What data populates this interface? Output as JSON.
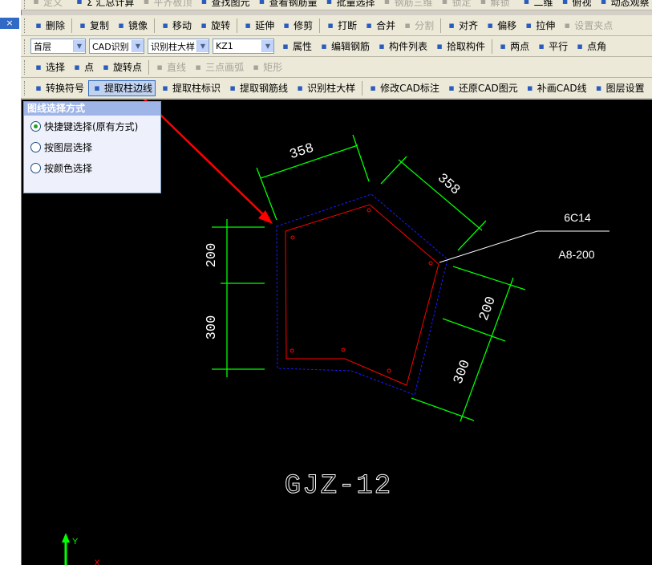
{
  "toolbar_row0": [
    {
      "icon": "definition-icon",
      "label": "定义",
      "disabled": true
    },
    {
      "icon": "sigma-icon",
      "label": "Σ 汇总计算",
      "disabled": false
    },
    {
      "icon": "align-top-icon",
      "label": "平齐板顶",
      "disabled": true
    },
    {
      "icon": "find-icon",
      "label": "查找图元",
      "disabled": false
    },
    {
      "icon": "rebar-view-icon",
      "label": "查看钢筋量",
      "disabled": false
    },
    {
      "icon": "batch-select-icon",
      "label": "批量选择",
      "disabled": false
    },
    {
      "icon": "rebar-3d-icon",
      "label": "钢筋三维",
      "disabled": true
    },
    {
      "icon": "lock-icon",
      "label": "锁定",
      "disabled": true
    },
    {
      "icon": "unlock-icon",
      "label": "解锁",
      "disabled": true
    },
    {
      "icon": "2d-icon",
      "label": "二维",
      "disabled": false
    },
    {
      "icon": "top-view-icon",
      "label": "俯视",
      "disabled": false
    },
    {
      "icon": "dynamic-view-icon",
      "label": "动态观察",
      "disabled": false
    }
  ],
  "toolbar_row1": [
    {
      "icon": "delete-icon",
      "label": "删除",
      "disabled": false
    },
    {
      "icon": "copy-icon",
      "label": "复制",
      "disabled": false
    },
    {
      "icon": "mirror-icon",
      "label": "镜像",
      "disabled": false
    },
    {
      "icon": "move-icon",
      "label": "移动",
      "disabled": false
    },
    {
      "icon": "rotate-icon",
      "label": "旋转",
      "disabled": false
    },
    {
      "icon": "extend-icon",
      "label": "延伸",
      "disabled": false
    },
    {
      "icon": "trim-icon",
      "label": "修剪",
      "disabled": false
    },
    {
      "icon": "break-icon",
      "label": "打断",
      "disabled": false
    },
    {
      "icon": "merge-icon",
      "label": "合并",
      "disabled": false
    },
    {
      "icon": "split-icon",
      "label": "分割",
      "disabled": true
    },
    {
      "icon": "align-icon",
      "label": "对齐",
      "disabled": false
    },
    {
      "icon": "offset-icon",
      "label": "偏移",
      "disabled": false
    },
    {
      "icon": "stretch-icon",
      "label": "拉伸",
      "disabled": false
    },
    {
      "icon": "set-grip-icon",
      "label": "设置夹点",
      "disabled": true
    }
  ],
  "toolbar_row2": {
    "combos": [
      {
        "value": "首层"
      },
      {
        "value": "CAD识别"
      },
      {
        "value": "识别柱大样"
      },
      {
        "value": "KZ1"
      }
    ],
    "buttons": [
      {
        "icon": "properties-icon",
        "label": "属性",
        "disabled": false
      },
      {
        "icon": "edit-rebar-icon",
        "label": "编辑钢筋",
        "disabled": false
      },
      {
        "icon": "member-list-icon",
        "label": "构件列表",
        "disabled": false
      },
      {
        "icon": "pick-member-icon",
        "label": "拾取构件",
        "disabled": false
      },
      {
        "icon": "two-points-icon",
        "label": "两点",
        "disabled": false
      },
      {
        "icon": "parallel-icon",
        "label": "平行",
        "disabled": false
      },
      {
        "icon": "point-angle-icon",
        "label": "点角",
        "disabled": false
      }
    ]
  },
  "toolbar_row3": [
    {
      "icon": "select-icon",
      "label": "选择",
      "disabled": false
    },
    {
      "icon": "point-icon",
      "label": "点",
      "disabled": false
    },
    {
      "icon": "rotate-point-icon",
      "label": "旋转点",
      "disabled": false
    },
    {
      "icon": "line-icon",
      "label": "直线",
      "disabled": true
    },
    {
      "icon": "arc-icon",
      "label": "三点画弧",
      "disabled": true
    },
    {
      "icon": "rect-icon",
      "label": "矩形",
      "disabled": true
    }
  ],
  "toolbar_row4": [
    {
      "icon": "convert-symbol-icon",
      "label": "转换符号",
      "active": false
    },
    {
      "icon": "extract-edge-icon",
      "label": "提取柱边线",
      "active": true
    },
    {
      "icon": "extract-label-icon",
      "label": "提取柱标识",
      "active": false
    },
    {
      "icon": "extract-rebar-line-icon",
      "label": "提取钢筋线",
      "active": false
    },
    {
      "icon": "identify-detail-icon",
      "label": "识别柱大样",
      "active": false
    },
    {
      "icon": "modify-cad-label-icon",
      "label": "修改CAD标注",
      "active": false
    },
    {
      "icon": "restore-cad-icon",
      "label": "还原CAD图元",
      "active": false
    },
    {
      "icon": "redraw-cad-icon",
      "label": "补画CAD线",
      "active": false
    },
    {
      "icon": "layer-settings-icon",
      "label": "图层设置",
      "active": false
    }
  ],
  "panel": {
    "title": "图线选择方式",
    "options": [
      {
        "label": "快捷键选择(原有方式)",
        "selected": true
      },
      {
        "label": "按图层选择",
        "selected": false
      },
      {
        "label": "按颜色选择",
        "selected": false
      }
    ]
  },
  "drawing": {
    "dims": [
      "358",
      "358",
      "200",
      "300",
      "200",
      "300"
    ],
    "annotation_top": "6C14",
    "annotation_bottom": "A8-200",
    "title": "GJZ-12",
    "axis_label": "Y"
  },
  "colors": {
    "dimension": "#00ff00",
    "outline": "#ff0000",
    "dashed_outline": "#0000cc",
    "arrow": "#ff0000",
    "canvas": "#000000"
  },
  "close_label": "×"
}
